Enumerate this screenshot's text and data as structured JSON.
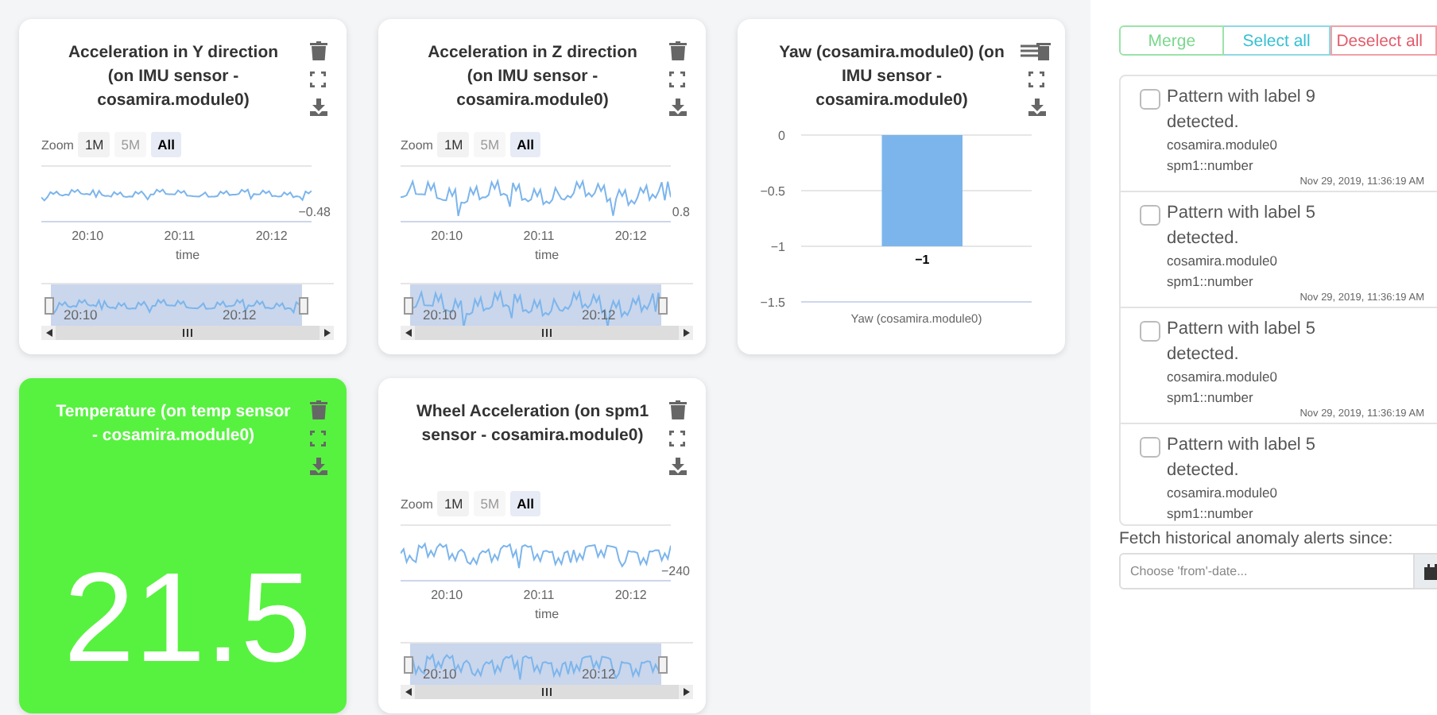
{
  "cards": [
    {
      "kind": "timeseries",
      "title": "Acceleration in Y direction (on IMU sensor - cosamira.module0)",
      "zoom_label": "Zoom",
      "zoom_buttons": [
        {
          "label": "1M",
          "selected": false,
          "disabled": false
        },
        {
          "label": "5M",
          "selected": false,
          "disabled": true
        },
        {
          "label": "All",
          "selected": true,
          "disabled": false
        }
      ],
      "last_value": "−0.48",
      "xticks": [
        "20:10",
        "20:11",
        "20:12"
      ],
      "xlabel": "time",
      "navigator_ticks": [
        "20:10",
        "20:12"
      ]
    },
    {
      "kind": "timeseries",
      "title": "Acceleration in Z direction (on IMU sensor - cosamira.module0)",
      "zoom_label": "Zoom",
      "zoom_buttons": [
        {
          "label": "1M",
          "selected": false,
          "disabled": false
        },
        {
          "label": "5M",
          "selected": false,
          "disabled": true
        },
        {
          "label": "All",
          "selected": true,
          "disabled": false
        }
      ],
      "last_value": "0.8",
      "xticks": [
        "20:10",
        "20:11",
        "20:12"
      ],
      "xlabel": "time",
      "navigator_ticks": [
        "20:10",
        "20:12"
      ]
    },
    {
      "kind": "bar",
      "title": "Yaw (cosamira.module0) (on IMU sensor - cosamira.module0)",
      "chart_data": {
        "type": "bar",
        "categories": [
          "Yaw (cosamira.module0)"
        ],
        "series": [
          {
            "color": "#7cb5ec",
            "values": [
              -1
            ]
          }
        ],
        "ylim": [
          -1.5,
          0
        ],
        "yticks": [
          {
            "value": 0,
            "label": "0"
          },
          {
            "value": -0.5,
            "label": "−0.5"
          },
          {
            "value": -1,
            "label": "−1"
          },
          {
            "value": -1.5,
            "label": "−1.5"
          }
        ],
        "value_labels": [
          "−1"
        ]
      }
    },
    {
      "kind": "value",
      "title": "Temperature (on temp sensor - cosamira.module0)",
      "value": "21.5",
      "color": "#57f23f"
    },
    {
      "kind": "timeseries",
      "title": "Wheel Acceleration (on spm1 sensor - cosamira.module0)",
      "zoom_label": "Zoom",
      "zoom_buttons": [
        {
          "label": "1M",
          "selected": false,
          "disabled": false
        },
        {
          "label": "5M",
          "selected": false,
          "disabled": true
        },
        {
          "label": "All",
          "selected": true,
          "disabled": false
        }
      ],
      "last_value": "−240",
      "xticks": [
        "20:10",
        "20:11",
        "20:12"
      ],
      "xlabel": "time",
      "navigator_ticks": [
        "20:10",
        "20:12"
      ]
    }
  ],
  "alerts": {
    "buttons": [
      {
        "kind": "merge",
        "label": "Merge"
      },
      {
        "kind": "select",
        "label": "Select all"
      },
      {
        "kind": "deselect",
        "label": "Deselect all"
      }
    ],
    "items": [
      {
        "title": "Pattern with label 9 detected.",
        "checked": false,
        "module": "cosamira.module0",
        "metric": "spm1::number",
        "time": "Nov 29, 2019, 11:36:19 AM"
      },
      {
        "title": "Pattern with label 5 detected.",
        "checked": false,
        "module": "cosamira.module0",
        "metric": "spm1::number",
        "time": "Nov 29, 2019, 11:36:19 AM"
      },
      {
        "title": "Pattern with label 5 detected.",
        "checked": false,
        "module": "cosamira.module0",
        "metric": "spm1::number",
        "time": "Nov 29, 2019, 11:36:19 AM"
      },
      {
        "title": "Pattern with label 5 detected.",
        "checked": false,
        "module": "cosamira.module0",
        "metric": "spm1::number"
      }
    ],
    "fetch_label": "Fetch historical anomaly alerts since:",
    "date_field": {
      "placeholder": "Choose 'from'-date..."
    }
  }
}
